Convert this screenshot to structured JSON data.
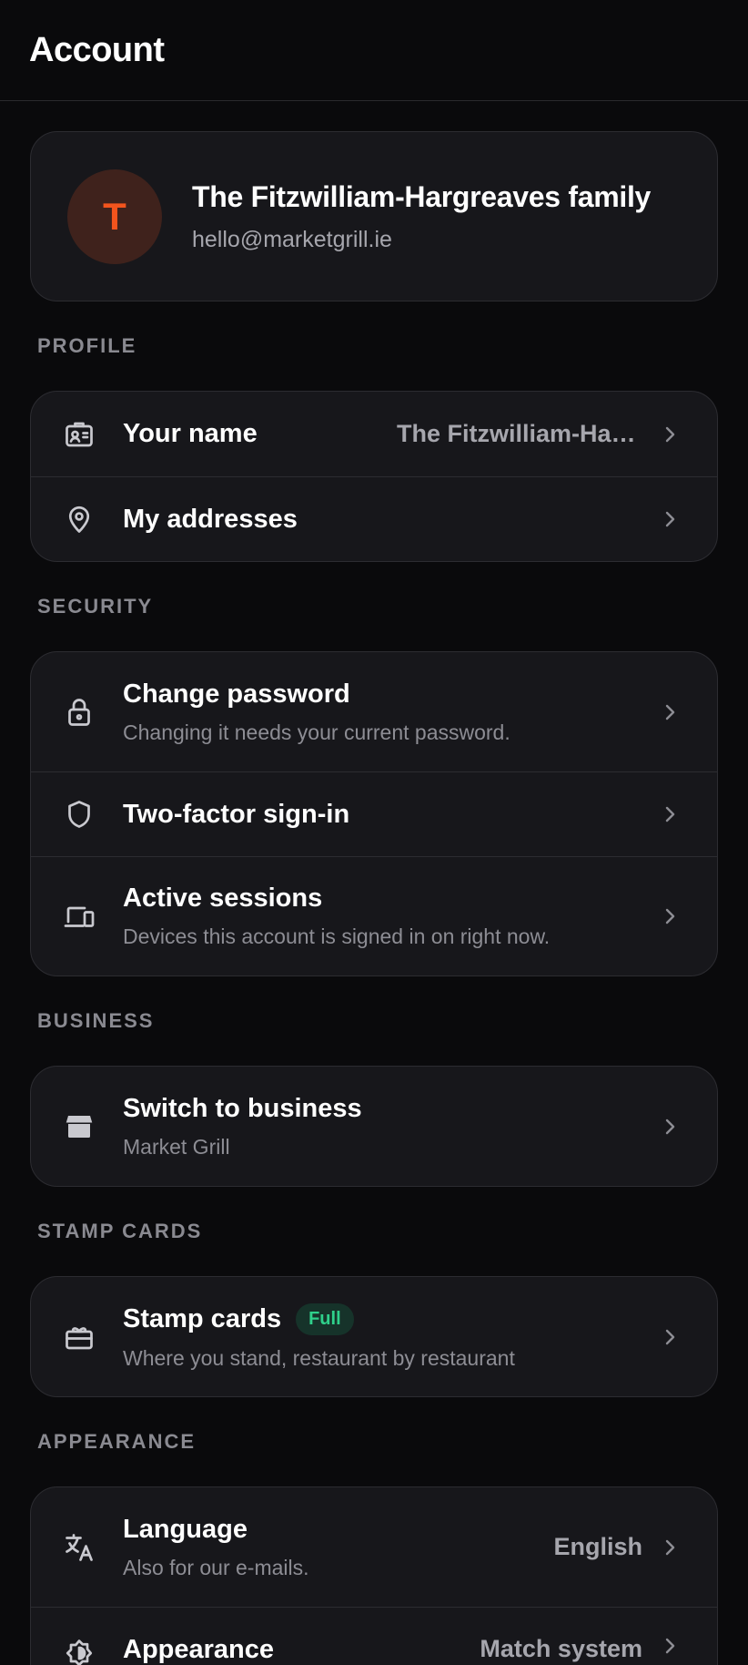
{
  "header": {
    "title": "Account"
  },
  "profile": {
    "avatar_initial": "T",
    "name": "The Fitzwilliam-Hargreaves family",
    "email": "hello@marketgrill.ie"
  },
  "sections": {
    "profile": {
      "label": "PROFILE",
      "your_name": {
        "title": "Your name",
        "value": "The Fitzwilliam-Hargreaves family"
      },
      "addresses": {
        "title": "My addresses"
      }
    },
    "security": {
      "label": "SECURITY",
      "password": {
        "title": "Change password",
        "subtitle": "Changing it needs your current password."
      },
      "two_factor": {
        "title": "Two-factor sign-in"
      },
      "sessions": {
        "title": "Active sessions",
        "subtitle": "Devices this account is signed in on right now."
      }
    },
    "business": {
      "label": "BUSINESS",
      "switch": {
        "title": "Switch to business",
        "subtitle": "Market Grill"
      }
    },
    "stamp_cards": {
      "label": "STAMP CARDS",
      "stamp": {
        "title": "Stamp cards",
        "badge": "Full",
        "subtitle": "Where you stand, restaurant by restaurant"
      }
    },
    "appearance": {
      "label": "APPEARANCE",
      "language": {
        "title": "Language",
        "subtitle": "Also for our e-mails.",
        "value": "English"
      },
      "theme": {
        "title": "Appearance",
        "value": "Match system"
      }
    }
  },
  "colors": {
    "accent": "#f3541d",
    "badge_green": "#2fd08b",
    "background": "#0a0a0c",
    "card": "#17171b"
  }
}
